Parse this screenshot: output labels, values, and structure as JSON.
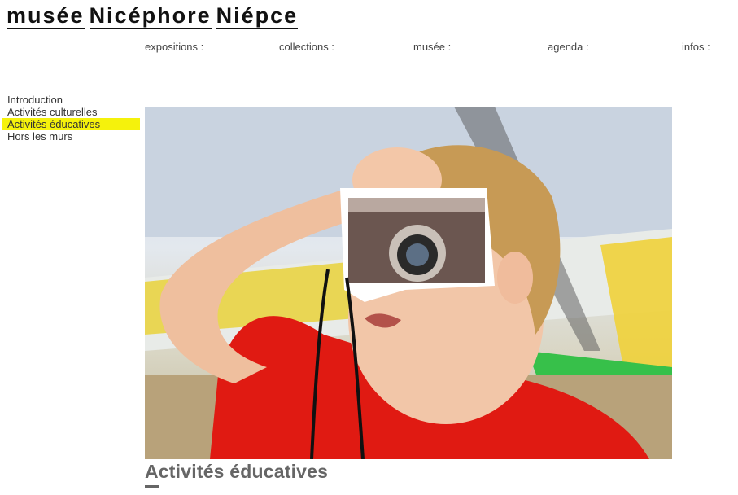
{
  "logo": {
    "words": [
      "musée",
      "Nicéphore",
      "Niépce"
    ]
  },
  "topnav": {
    "items": [
      "expositions :",
      "collections :",
      "musée :",
      "agenda :",
      "infos :"
    ]
  },
  "sidenav": {
    "items": [
      "Introduction",
      "Activités culturelles",
      "Activités éducatives",
      "Hors les murs"
    ],
    "active_index": 2,
    "highlight_color": "#f5f20c"
  },
  "main": {
    "heading": "Activités éducatives"
  }
}
